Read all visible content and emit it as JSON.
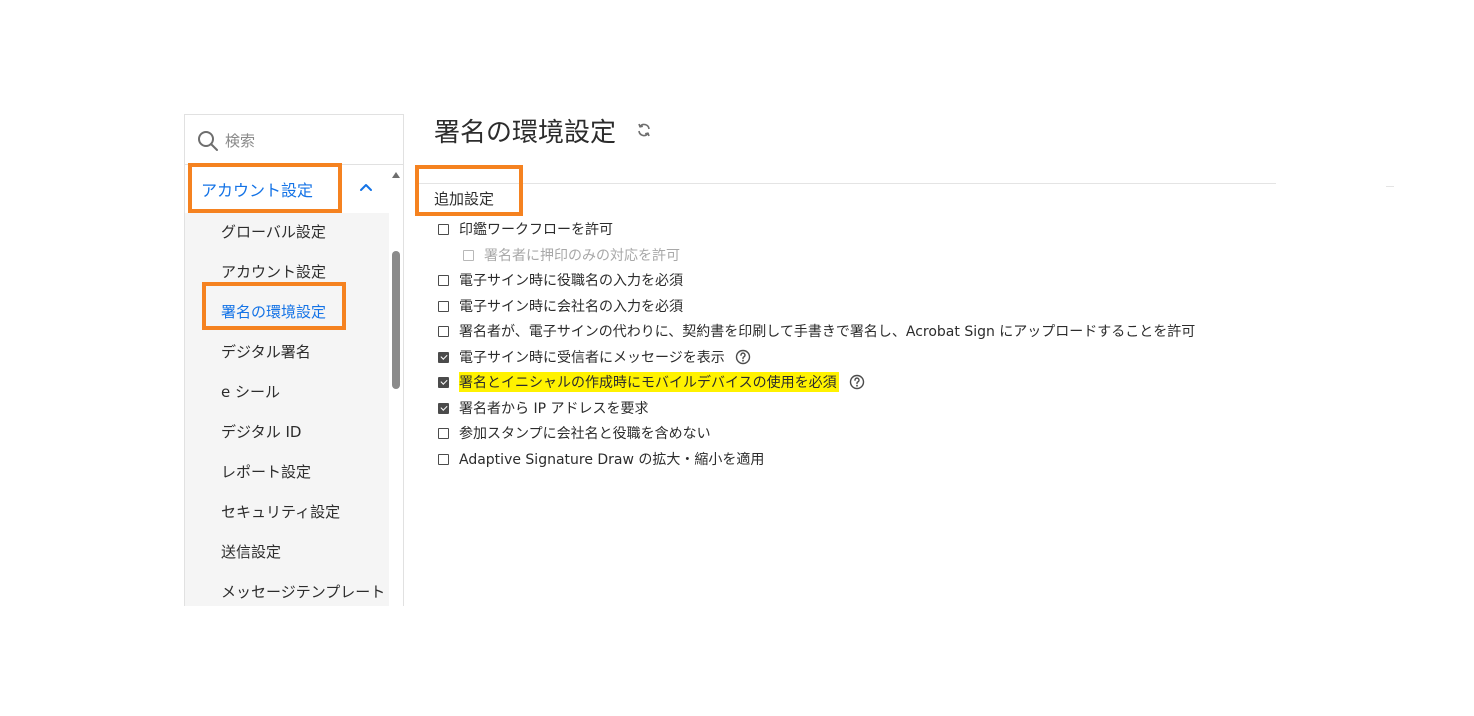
{
  "search": {
    "placeholder": "検索",
    "icon": "search-icon"
  },
  "sidebar": {
    "section_label": "アカウント設定",
    "section_expanded": true,
    "items": [
      {
        "label": "グローバル設定",
        "active": false
      },
      {
        "label": "アカウント設定",
        "active": false
      },
      {
        "label": "署名の環境設定",
        "active": true
      },
      {
        "label": "デジタル署名",
        "active": false
      },
      {
        "label": "e シール",
        "active": false
      },
      {
        "label": "デジタル ID",
        "active": false
      },
      {
        "label": "レポート設定",
        "active": false
      },
      {
        "label": "セキュリティ設定",
        "active": false
      },
      {
        "label": "送信設定",
        "active": false
      },
      {
        "label": "メッセージテンプレート",
        "active": false
      }
    ]
  },
  "main": {
    "title": "署名の環境設定",
    "section_title": "追加設定",
    "options": [
      {
        "label": "印鑑ワークフローを許可",
        "checked": false,
        "disabled": false,
        "indent": false,
        "help": false,
        "highlight": false
      },
      {
        "label": "署名者に押印のみの対応を許可",
        "checked": false,
        "disabled": true,
        "indent": true,
        "help": false,
        "highlight": false
      },
      {
        "label": "電子サイン時に役職名の入力を必須",
        "checked": false,
        "disabled": false,
        "indent": false,
        "help": false,
        "highlight": false
      },
      {
        "label": "電子サイン時に会社名の入力を必須",
        "checked": false,
        "disabled": false,
        "indent": false,
        "help": false,
        "highlight": false
      },
      {
        "label": "署名者が、電子サインの代わりに、契約書を印刷して手書きで署名し、Acrobat Sign にアップロードすることを許可",
        "checked": false,
        "disabled": false,
        "indent": false,
        "help": false,
        "highlight": false
      },
      {
        "label": "電子サイン時に受信者にメッセージを表示",
        "checked": true,
        "disabled": false,
        "indent": false,
        "help": true,
        "highlight": false
      },
      {
        "label": "署名とイニシャルの作成時にモバイルデバイスの使用を必須",
        "checked": true,
        "disabled": false,
        "indent": false,
        "help": true,
        "highlight": true
      },
      {
        "label": "署名者から IP アドレスを要求",
        "checked": true,
        "disabled": false,
        "indent": false,
        "help": false,
        "highlight": false
      },
      {
        "label": "参加スタンプに会社名と役職を含めない",
        "checked": false,
        "disabled": false,
        "indent": false,
        "help": false,
        "highlight": false
      },
      {
        "label": "Adaptive Signature Draw の拡大・縮小を適用",
        "checked": false,
        "disabled": false,
        "indent": false,
        "help": false,
        "highlight": false
      }
    ]
  },
  "colors": {
    "accent": "#1473e6",
    "annotation": "#f58220",
    "highlight": "#fff200"
  }
}
